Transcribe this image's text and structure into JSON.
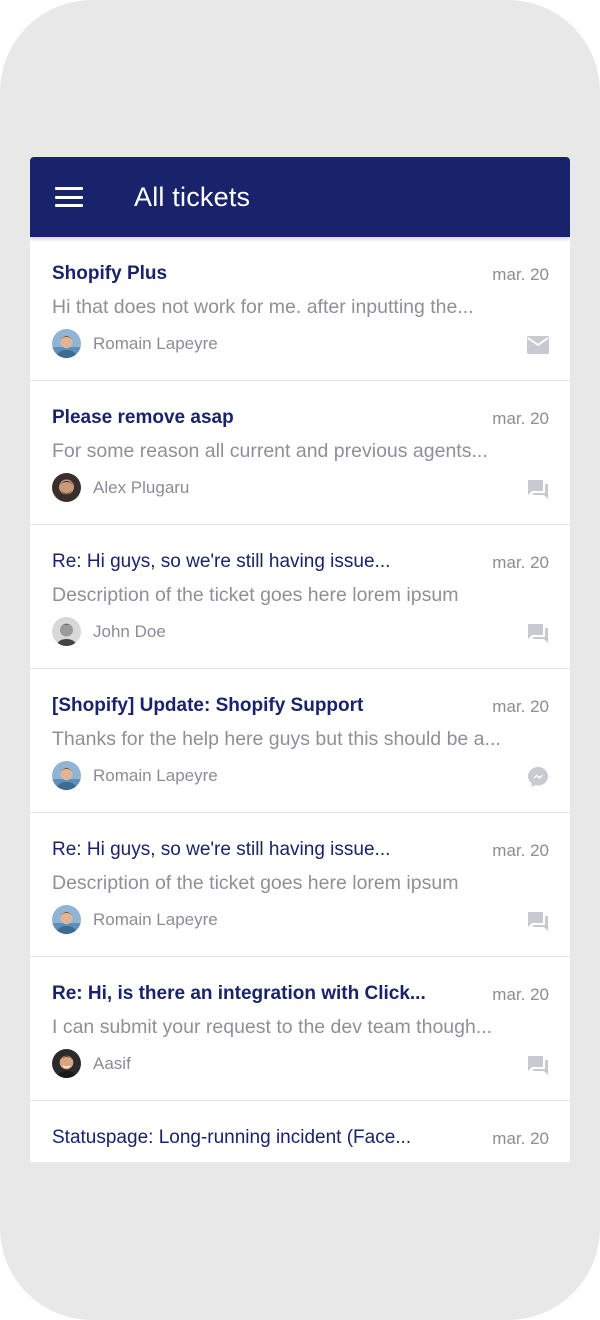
{
  "header": {
    "title": "All tickets",
    "menu_icon": "hamburger-menu-icon",
    "background": "#19236c"
  },
  "tickets": [
    {
      "title": "Shopify Plus",
      "date": "mar. 20",
      "preview": "Hi that does not work for me. after inputting the...",
      "author": "Romain Lapeyre",
      "unread": true,
      "channel_icon": "email-icon"
    },
    {
      "title": "Please remove asap",
      "date": "mar. 20",
      "preview": "For some reason all current and previous agents...",
      "author": "Alex Plugaru",
      "unread": true,
      "channel_icon": "chat-icon"
    },
    {
      "title": "Re: Hi guys, so we're still having issue...",
      "date": "mar. 20",
      "preview": "Description of the ticket goes here lorem ipsum",
      "author": "John Doe",
      "unread": false,
      "channel_icon": "chat-icon"
    },
    {
      "title": "[Shopify] Update: Shopify Support",
      "date": "mar. 20",
      "preview": "Thanks for the help here guys but this should be a...",
      "author": "Romain Lapeyre",
      "unread": true,
      "channel_icon": "messenger-icon"
    },
    {
      "title": "Re: Hi guys, so we're still having issue...",
      "date": "mar. 20",
      "preview": "Description of the ticket goes here lorem ipsum",
      "author": "Romain Lapeyre",
      "unread": false,
      "channel_icon": "chat-icon"
    },
    {
      "title": "Re: Hi, is there an integration with Click...",
      "date": "mar. 20",
      "preview": "I can submit your request to the dev team though...",
      "author": "Aasif",
      "unread": true,
      "channel_icon": "chat-icon"
    },
    {
      "title": "Statuspage: Long-running incident (Face...",
      "date": "mar. 20",
      "unread": false
    }
  ],
  "colors": {
    "title": "#19236c",
    "muted": "#8f8f99",
    "icon": "#c9c9d2"
  }
}
